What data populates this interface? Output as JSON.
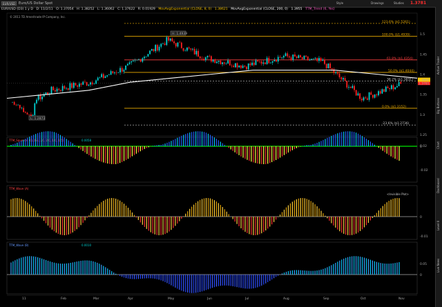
{
  "toolbar": {
    "symbol": "EUR/USD",
    "description": "Euro/US Dollar Spot",
    "buttons": [
      "Style",
      "Drawings",
      "Studies"
    ],
    "last_price": "1.3781"
  },
  "header": {
    "chart_label": "EUR/USD (D3) 1 y D",
    "date": "D: 11/2/11",
    "open": "O: 1.37054",
    "high": "H: 1.38252",
    "low": "L: 1.36062",
    "close": "C: 1.37622",
    "change": "R: 0.01929",
    "ma1": "MovAvgExponential (CLOSE, 8, 0)",
    "ma1_value": "1.38621",
    "ma2": "MovAvgExponential (CLOSE, 200, 0)",
    "ma2_value": "1.3955",
    "ttm": "TTM_Trend (6, Yes)",
    "copyright": "© 2011 TD Ameritrade IP Company, Inc."
  },
  "colors": {
    "up": "#00d0d0",
    "down": "#ff2020",
    "ma": "#ffffff",
    "fib": "#f0b000",
    "zero": "#00c000"
  },
  "fib_levels": [
    {
      "label": "123.6% ($1.5261)",
      "value": 1.5261,
      "color": "#f0b000"
    },
    {
      "label": "100.0% ($1.4939)",
      "value": 1.4939,
      "color": "#f0b000"
    },
    {
      "label": "61.8% ($1.4354)",
      "value": 1.4354,
      "color": "#ff4040"
    },
    {
      "label": "50.0% ($1.4044)",
      "value": 1.4044,
      "color": "#f0b000"
    },
    {
      "label": "38.2% ($1.3831)",
      "value": 1.3831,
      "color": "#cccccc"
    },
    {
      "label": "0.0% ($1.3152)",
      "value": 1.3152,
      "color": "#f0b000"
    },
    {
      "label": "-23.6% ($1.2736)",
      "value": 1.2736,
      "color": "#cccccc"
    }
  ],
  "annotations": {
    "high": "H: 1.4939",
    "low": "L: 1.2873"
  },
  "price_axis": {
    "ticks": [
      "1.5",
      "1.45",
      "1.4",
      "1.35",
      "1.3",
      "1.25"
    ],
    "current": "1.3781",
    "current2": "1.3862"
  },
  "x_axis": [
    "11",
    "Feb",
    "Mar",
    "Apr",
    "May",
    "Jun",
    "Jul",
    "Aug",
    "Sep",
    "Oct",
    "Nov"
  ],
  "panels": [
    {
      "tag": "TTM_Squeeze",
      "params": "(CLOSE, 20, 2.0, 1.0, 1.5)",
      "value": "0.0058",
      "ticks": [
        "0.02",
        "0",
        "-0.02"
      ]
    },
    {
      "tag": "TTM_Wave",
      "params": "(A)",
      "value": "",
      "right_label": "<Invisible Plot>",
      "ticks": [
        "0",
        "-0.01"
      ]
    },
    {
      "tag": "TTM_Wave",
      "params": "(B)",
      "value": "0.0010",
      "ticks": [
        "0.05",
        "0"
      ]
    }
  ],
  "right_tabs": [
    "Active Trader",
    "Big Buttons",
    "Chart",
    "Dashboard",
    "Level II",
    "Live News"
  ],
  "chart_data": {
    "type": "candlestick",
    "title": "Euro/US Dollar Spot",
    "xlabel": "",
    "ylabel": "",
    "x": [
      "11",
      "Feb",
      "Mar",
      "Apr",
      "May",
      "Jun",
      "Jul",
      "Aug",
      "Sep",
      "Oct",
      "Nov"
    ],
    "approx_close": [
      1.33,
      1.37,
      1.38,
      1.42,
      1.48,
      1.44,
      1.42,
      1.44,
      1.43,
      1.34,
      1.38
    ],
    "ylim": [
      1.25,
      1.55
    ],
    "series": [
      {
        "name": "MovAvgExponential (CLOSE, 200, 0)",
        "values": [
          1.34,
          1.35,
          1.36,
          1.38,
          1.39,
          1.4,
          1.41,
          1.41,
          1.41,
          1.4,
          1.39
        ]
      }
    ]
  }
}
